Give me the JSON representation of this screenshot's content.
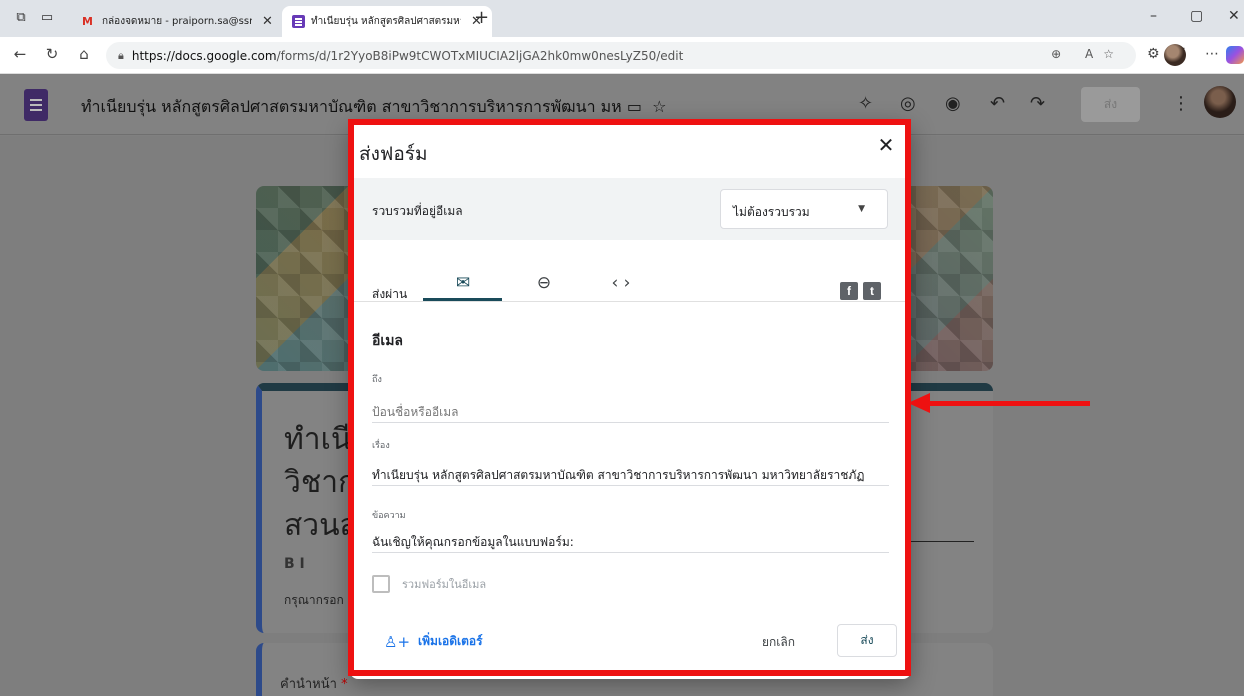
{
  "browser": {
    "tabs": [
      {
        "title": "กล่องจดหมาย - praiporn.sa@ssru.ac",
        "icon": "gmail-icon"
      },
      {
        "title": "ทำเนียบรุ่น หลักสูตรศิลปศาสตรมหาบัณ",
        "icon": "forms-icon"
      }
    ],
    "url_host": "https://docs.google.com",
    "url_path": "/forms/d/1r2YyoB8iPw9tCWOTxMIUCIA2ljGA2hk0mw0nesLyZ50/edit"
  },
  "forms_header": {
    "title": "ทำเนียบรุ่น หลักสูตรศิลปศาสตรมหาบัณฑิต สาขาวิชาการบริหารการพัฒนา มห",
    "send_label": "ส่ง"
  },
  "form_canvas": {
    "title_lines": [
      "ทำเนีย",
      "วิชาก",
      "สวนสุ"
    ],
    "format_tools": "B   I",
    "description_prefix": "กรุณากรอก",
    "question_label": "คำนำหน้า",
    "required_mark": "*"
  },
  "dialog": {
    "title": "ส่งฟอร์ม",
    "collect_label": "รวบรวมที่อยู่อีเมล",
    "collect_value": "ไม่ต้องรวบรวม",
    "send_via_label": "ส่งผ่าน",
    "email_heading": "อีเมล",
    "to_label": "ถึง",
    "to_placeholder": "ป้อนชื่อหรืออีเมล",
    "subject_label": "เรื่อง",
    "subject_value": "ทำเนียบรุ่น หลักสูตรศิลปศาสตรมหาบัณฑิต สาขาวิชาการบริหารการพัฒนา มหาวิทยาลัยราชภัฏ",
    "message_label": "ข้อความ",
    "message_value": "ฉันเชิญให้คุณกรอกข้อมูลในแบบฟอร์ม:",
    "include_form_label": "รวมฟอร์มในอีเมล",
    "add_editor_label": "เพิ่มเอดิเตอร์",
    "cancel_label": "ยกเลิก",
    "send_label": "ส่ง"
  },
  "colors": {
    "annotation_red": "#e11111",
    "forms_purple": "#673ab7",
    "link_blue": "#1a73e8",
    "tab_accent": "#1a4b5a"
  }
}
